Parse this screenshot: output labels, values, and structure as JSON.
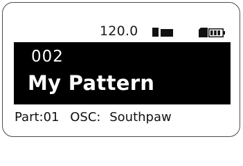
{
  "status": {
    "tempo": "120.0",
    "tempo_suffix_icon": "locked-tempo-icon",
    "record_icon": "record-indicator-icon",
    "card_icon": "sd-card-icon",
    "battery_icon": "battery-icon"
  },
  "pattern": {
    "number": "002",
    "name": "My Pattern"
  },
  "info": {
    "part": "Part:01",
    "osc_label": "OSC:",
    "osc_value": "Southpaw"
  }
}
